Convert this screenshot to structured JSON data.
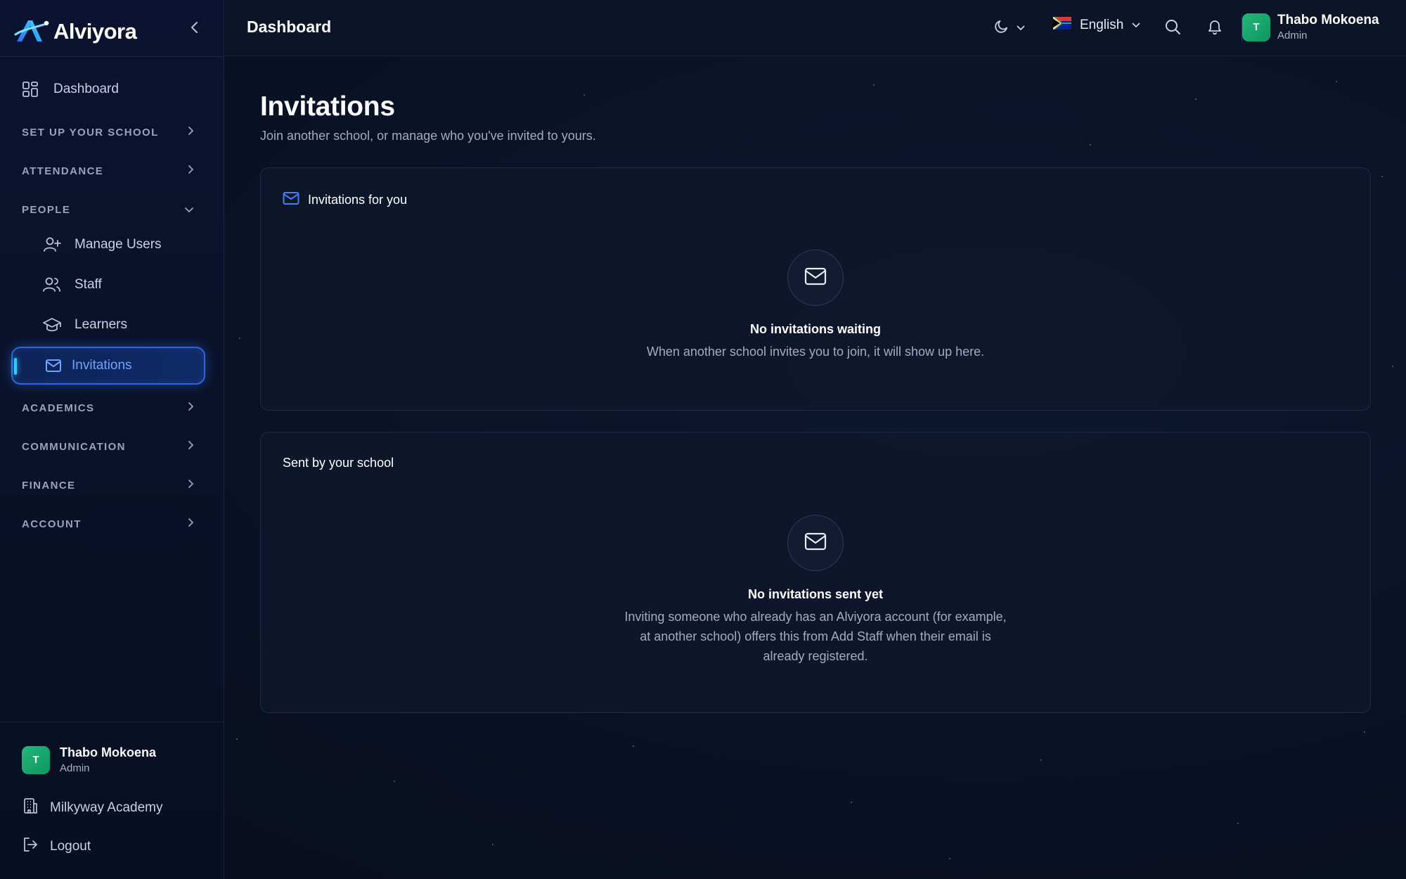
{
  "brand": {
    "name": "Alviyora"
  },
  "header": {
    "title": "Dashboard",
    "language": "English",
    "user": {
      "initial": "T",
      "name": "Thabo Mokoena",
      "role": "Admin"
    }
  },
  "sidebar": {
    "dashboard": "Dashboard",
    "sections": {
      "setup": "SET UP YOUR SCHOOL",
      "attendance": "ATTENDANCE",
      "people": "PEOPLE",
      "academics": "ACADEMICS",
      "communication": "COMMUNICATION",
      "finance": "FINANCE",
      "account": "ACCOUNT"
    },
    "people_items": {
      "manage_users": "Manage Users",
      "staff": "Staff",
      "learners": "Learners",
      "invitations": "Invitations"
    },
    "footer": {
      "user": {
        "initial": "T",
        "name": "Thabo Mokoena",
        "role": "Admin"
      },
      "school": "Milkyway Academy",
      "logout": "Logout"
    }
  },
  "main": {
    "title": "Invitations",
    "subtitle": "Join another school, or manage who you've invited to yours.",
    "incoming": {
      "title": "Invitations for you",
      "empty_title": "No invitations waiting",
      "empty_text": "When another school invites you to join, it will show up here."
    },
    "sent": {
      "title": "Sent by your school",
      "empty_title": "No invitations sent yet",
      "empty_text": "Inviting someone who already has an Alviyora account (for example, at another school) offers this from Add Staff when their email is already registered."
    }
  },
  "colors": {
    "accent": "#3b82f6",
    "active_text": "#6ea3ff",
    "avatar": "#1fb97a",
    "background": "#0a1124"
  }
}
